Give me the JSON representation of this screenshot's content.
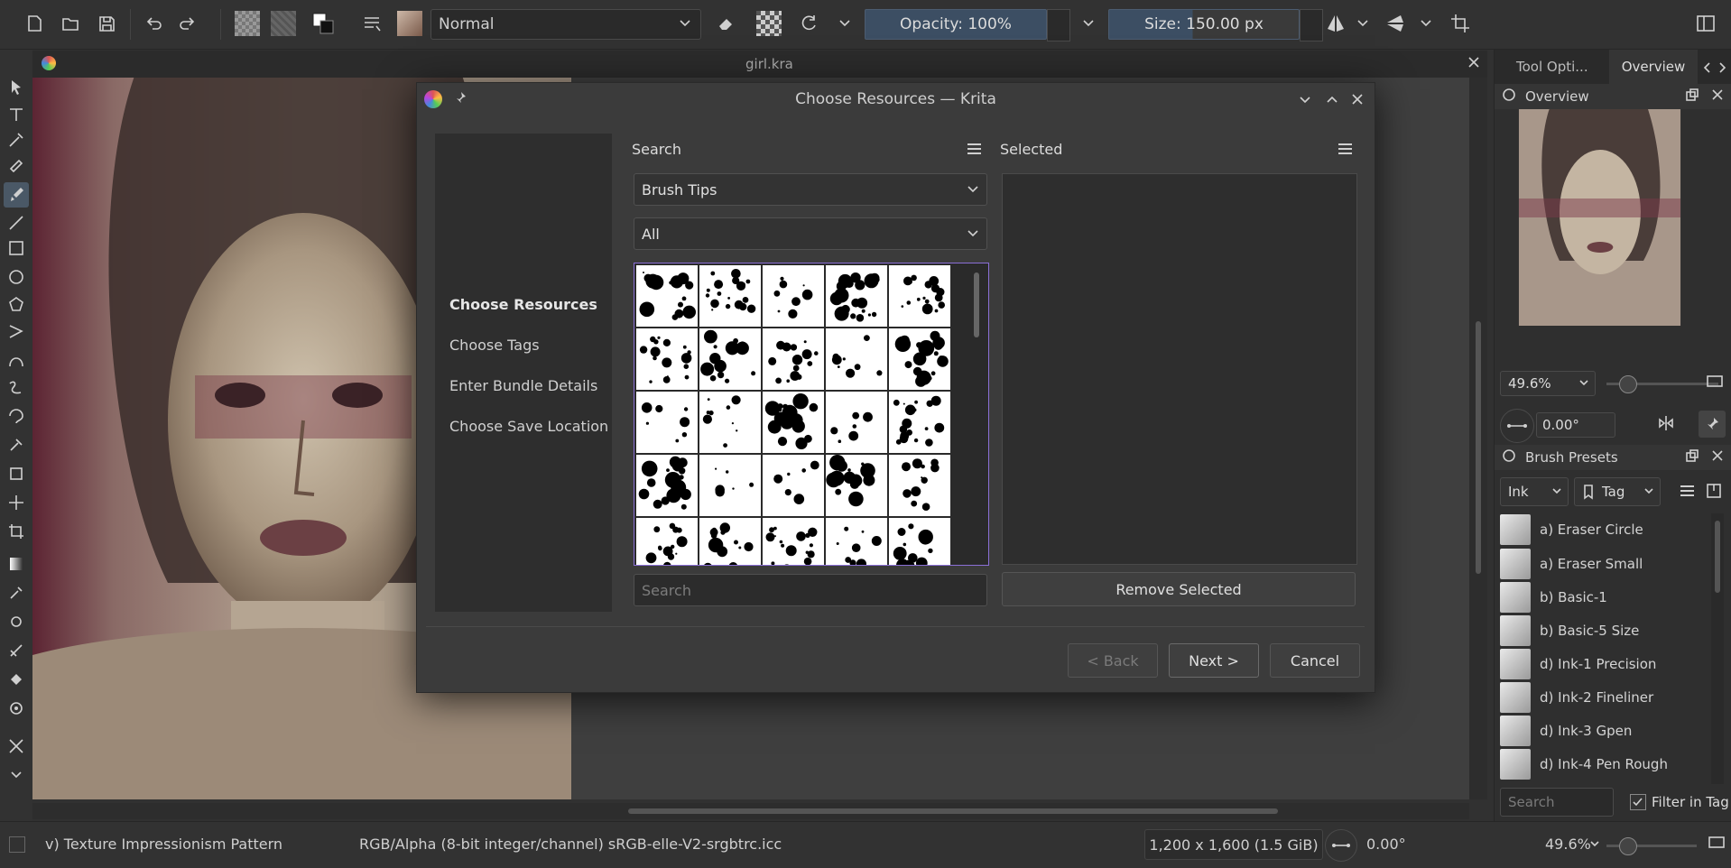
{
  "toolbar": {
    "blend_mode": "Normal",
    "opacity_label": "Opacity: 100%",
    "size_label": "Size: 150.00 px"
  },
  "document": {
    "tab_title": "girl.kra"
  },
  "dock": {
    "tabs": [
      "Tool Opti...",
      "Overview"
    ],
    "overview_title": "Overview",
    "zoom": "49.6%",
    "rotation": "0.00°",
    "presets_title": "Brush Presets",
    "preset_filter": "Ink",
    "tag_label": "Tag",
    "presets": [
      "a) Eraser Circle",
      "a) Eraser Small",
      "b) Basic-1",
      "b) Basic-5 Size",
      "d) Ink-1 Precision",
      "d) Ink-2 Fineliner",
      "d) Ink-3 Gpen",
      "d) Ink-4 Pen Rough"
    ],
    "search_placeholder": "Search",
    "filter_in_tag": "Filter in Tag"
  },
  "status": {
    "brush": "v) Texture Impressionism Pattern",
    "colorspace": "RGB/Alpha (8-bit integer/channel)  sRGB-elle-V2-srgbtrc.icc",
    "doc_size": "1,200 x 1,600 (1.5 GiB)",
    "rotation": "0.00°",
    "zoom": "49.6%"
  },
  "dialog": {
    "title": "Choose Resources — Krita",
    "steps": [
      "Choose Resources",
      "Choose Tags",
      "Enter Bundle Details",
      "Choose Save Location"
    ],
    "active_step": 0,
    "search_label": "Search",
    "resource_type": "Brush Tips",
    "tag_filter": "All",
    "search_placeholder": "Search",
    "selected_label": "Selected",
    "remove_selected": "Remove Selected",
    "back": "< Back",
    "next": "Next >",
    "cancel": "Cancel"
  },
  "colors": {
    "accent": "#8a6fd6",
    "slider": "#3c4e63",
    "panel": "#3b3b3b"
  }
}
